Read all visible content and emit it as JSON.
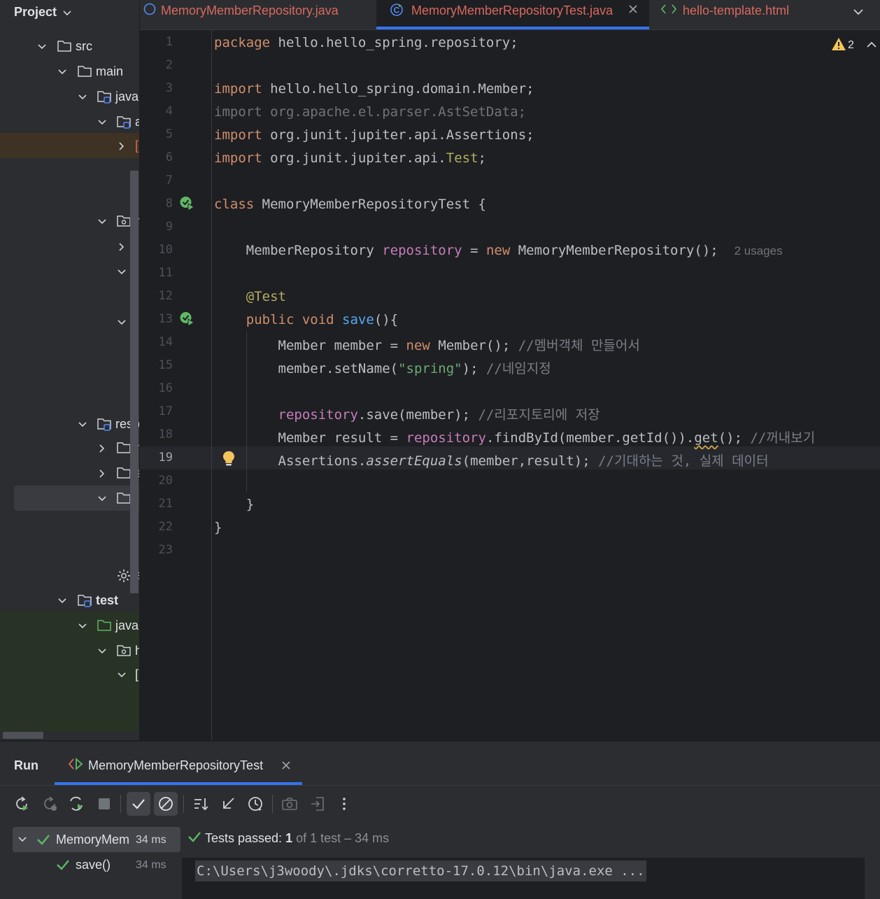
{
  "project": {
    "title": "Project",
    "tree": [
      {
        "label": "src"
      },
      {
        "label": "main"
      },
      {
        "label": "java"
      },
      {
        "label": "resources",
        "visible": "reso"
      },
      {
        "label": "test"
      },
      {
        "label": "java"
      }
    ],
    "clipped_glyphs": [
      "a",
      "[",
      "h",
      "[",
      "[",
      "[",
      "r",
      "s",
      "t",
      "a",
      "h",
      "["
    ]
  },
  "tabs": [
    {
      "label": "MemoryMemberRepository.java",
      "icon": "java-class-icon",
      "active": false
    },
    {
      "label": "MemoryMemberRepositoryTest.java",
      "icon": "java-test-class-icon",
      "active": true
    },
    {
      "label": "hello-template.html",
      "icon": "html-file-icon",
      "active": false
    }
  ],
  "editor": {
    "warning_count": "2",
    "current_line": 19,
    "line_numbers": [
      "1",
      "2",
      "3",
      "4",
      "5",
      "6",
      "7",
      "8",
      "9",
      "10",
      "11",
      "12",
      "13",
      "14",
      "15",
      "16",
      "17",
      "18",
      "19",
      "20",
      "21",
      "22",
      "23"
    ],
    "code": {
      "l1_kw": "package",
      "l1_rest": " hello.hello_spring.repository;",
      "l3_kw": "import",
      "l3_rest": " hello.hello_spring.domain.Member;",
      "l4": "import org.apache.el.parser.AstSetData;",
      "l5_kw": "import",
      "l5_rest": " org.junit.jupiter.api.Assertions;",
      "l6_kw": "import",
      "l6_rest": " org.junit.jupiter.api.",
      "l6_ann": "Test",
      "l6_end": ";",
      "l8_kw": "class",
      "l8_rest": " MemoryMemberRepositoryTest {",
      "l10_type": "MemberRepository ",
      "l10_field": "repository",
      "l10_eq": " = ",
      "l10_kw": "new",
      "l10_rest": " MemoryMemberRepository();",
      "l10_hint": "2 usages",
      "l12_ann": "@Test",
      "l13_kw": "public void",
      "l13_fn": " save",
      "l13_rest": "(){",
      "l14_a": "Member member = ",
      "l14_kw": "new",
      "l14_b": " Member(); ",
      "l14_cmt": "//멤버객체 만들어서",
      "l15_a": "member.setName(",
      "l15_str": "\"spring\"",
      "l15_b": "); ",
      "l15_cmt": "//네임지정",
      "l17_field": "repository",
      "l17_rest": ".save(member); ",
      "l17_cmt": "//리포지토리에 저장",
      "l18_a": "Member result = ",
      "l18_field": "repository",
      "l18_b": ".findById(member.getId()).",
      "l18_get": "get",
      "l18_c": "(); ",
      "l18_cmt": "//꺼내보기",
      "l19_a": "Assertions.",
      "l19_ital": "assertEquals",
      "l19_b": "(member,result); ",
      "l19_cmt": "//기대하는 것, 실제 데이터",
      "l21": "}",
      "l22": "}"
    }
  },
  "run": {
    "title": "Run",
    "config_tab": "MemoryMemberRepositoryTest",
    "tree_root": "MemoryMem",
    "tree_root_time": "34 ms",
    "tree_child": "save()",
    "tree_child_time": "34 ms",
    "status_prefix": "Tests passed:",
    "status_count": "1",
    "status_suffix": "of 1 test – 34 ms",
    "console_line": "C:\\Users\\j3woody\\.jdks\\corretto-17.0.12\\bin\\java.exe ..."
  },
  "colors": {
    "accent": "#3574f0",
    "success": "#5fb865",
    "keyword": "#cf8e6d",
    "field": "#c77dbb",
    "string": "#6aab73",
    "function": "#56a8f5",
    "annotation": "#b3ae60",
    "comment": "#7a7e85",
    "tab_inactive_text": "#d8695f",
    "warning": "#f2c55c"
  }
}
